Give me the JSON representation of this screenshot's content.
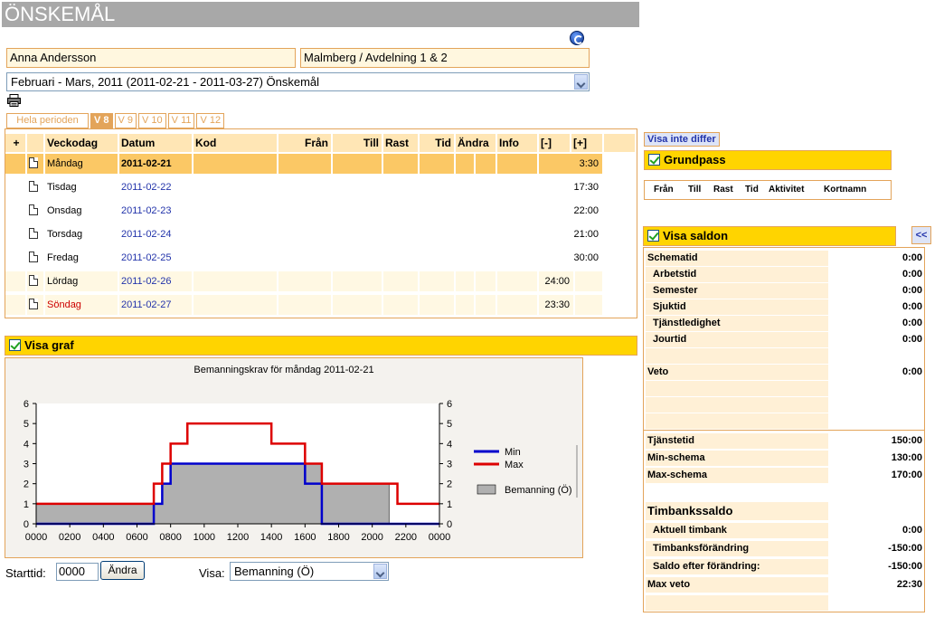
{
  "app": {
    "title": "ÖNSKEMÅL",
    "employee_name": "Anna Andersson",
    "unit": "Malmberg / Avdelning 1 & 2",
    "period": "Februari - Mars, 2011 (2011-02-21 - 2011-03-27) Önskemål",
    "icons": {
      "help": "help-icon",
      "print": "printer-icon"
    }
  },
  "tabs": [
    "Hela perioden",
    "V 8",
    "V 9",
    "V 10",
    "V 11",
    "V 12"
  ],
  "table": {
    "headers": [
      "+",
      "Veckodag",
      "Datum",
      "Kod",
      "Från",
      "Till",
      "Rast",
      "Tid",
      "Ändra",
      "Info",
      "[-]",
      "[+]"
    ],
    "rows": [
      {
        "day": "Måndag",
        "date": "2011-02-21",
        "time": "3:30"
      },
      {
        "day": "Tisdag",
        "date": "2011-02-22",
        "time": "17:30"
      },
      {
        "day": "Onsdag",
        "date": "2011-02-23",
        "time": "22:00"
      },
      {
        "day": "Torsdag",
        "date": "2011-02-24",
        "time": "21:00"
      },
      {
        "day": "Fredag",
        "date": "2011-02-25",
        "time": "30:00"
      },
      {
        "day": "Lördag",
        "date": "2011-02-26",
        "time": "24:00"
      },
      {
        "day": "Söndag",
        "date": "2011-02-27",
        "time": "23:30"
      }
    ]
  },
  "graph": {
    "toggle_label": "Visa graf",
    "starttid_label": "Starttid:",
    "starttid_value": "0000",
    "andra_label": "Ändra",
    "visa_label": "Visa:",
    "visa_value": "Bemanning (Ö)"
  },
  "chart_data": {
    "type": "line",
    "title": "Bemanningskrav för måndag 2011-02-21",
    "x_ticks": [
      "0000",
      "0200",
      "0400",
      "0600",
      "0800",
      "1000",
      "1200",
      "1400",
      "1600",
      "1800",
      "2000",
      "2200",
      "0000"
    ],
    "ylim": [
      0,
      6
    ],
    "y_ticks": [
      "0",
      "1",
      "2",
      "3",
      "4",
      "5",
      "6"
    ],
    "series": [
      {
        "name": "Min",
        "color": "#0000cc",
        "step_x": [
          0,
          7,
          7.5,
          8,
          16,
          17
        ],
        "step_y": [
          0,
          1,
          2,
          3,
          2,
          0
        ]
      },
      {
        "name": "Max",
        "color": "#dd0000",
        "step_x": [
          0,
          7,
          7.5,
          8,
          9,
          14,
          16,
          17,
          21.5,
          24
        ],
        "step_y": [
          1,
          2,
          3,
          4,
          5,
          4,
          3,
          2,
          1,
          1
        ]
      },
      {
        "name": "Bemanning (Ö)",
        "color": "#b0b0b0",
        "step_x": [
          0,
          7.5,
          8,
          17,
          21
        ],
        "step_y": [
          1,
          2,
          3,
          2,
          0
        ]
      }
    ]
  },
  "right": {
    "visa_inte_differ": "Visa inte differ",
    "grundpass_title": "Grundpass",
    "grundpass_cols": [
      "Från",
      "Till",
      "Rast",
      "Tid",
      "Aktivitet",
      "Kortnamn"
    ],
    "saldon_title": "Visa saldon",
    "collapse_label": "<<",
    "saldo_rows": [
      {
        "label": "Schematid",
        "value": "0:00",
        "indent": false
      },
      {
        "label": "Arbetstid",
        "value": "0:00",
        "indent": true
      },
      {
        "label": "Semester",
        "value": "0:00",
        "indent": true
      },
      {
        "label": "Sjuktid",
        "value": "0:00",
        "indent": true
      },
      {
        "label": "Tjänstledighet",
        "value": "0:00",
        "indent": true
      },
      {
        "label": "Jourtid",
        "value": "0:00",
        "indent": true
      },
      {
        "label": "Veto",
        "value": "0:00",
        "indent": false
      }
    ],
    "saldo_rows2": [
      {
        "label": "Tjänstetid",
        "value": "150:00"
      },
      {
        "label": "Min-schema",
        "value": "130:00"
      },
      {
        "label": "Max-schema",
        "value": "170:00"
      }
    ],
    "timbank_title": "Timbankssaldo",
    "timbank_rows": [
      {
        "label": "Aktuell timbank",
        "value": "0:00"
      },
      {
        "label": "Timbanksförändring",
        "value": "-150:00"
      },
      {
        "label": "Saldo efter förändring:",
        "value": "-150:00"
      }
    ],
    "maxveto_label": "Max veto",
    "maxveto_value": "22:30"
  }
}
